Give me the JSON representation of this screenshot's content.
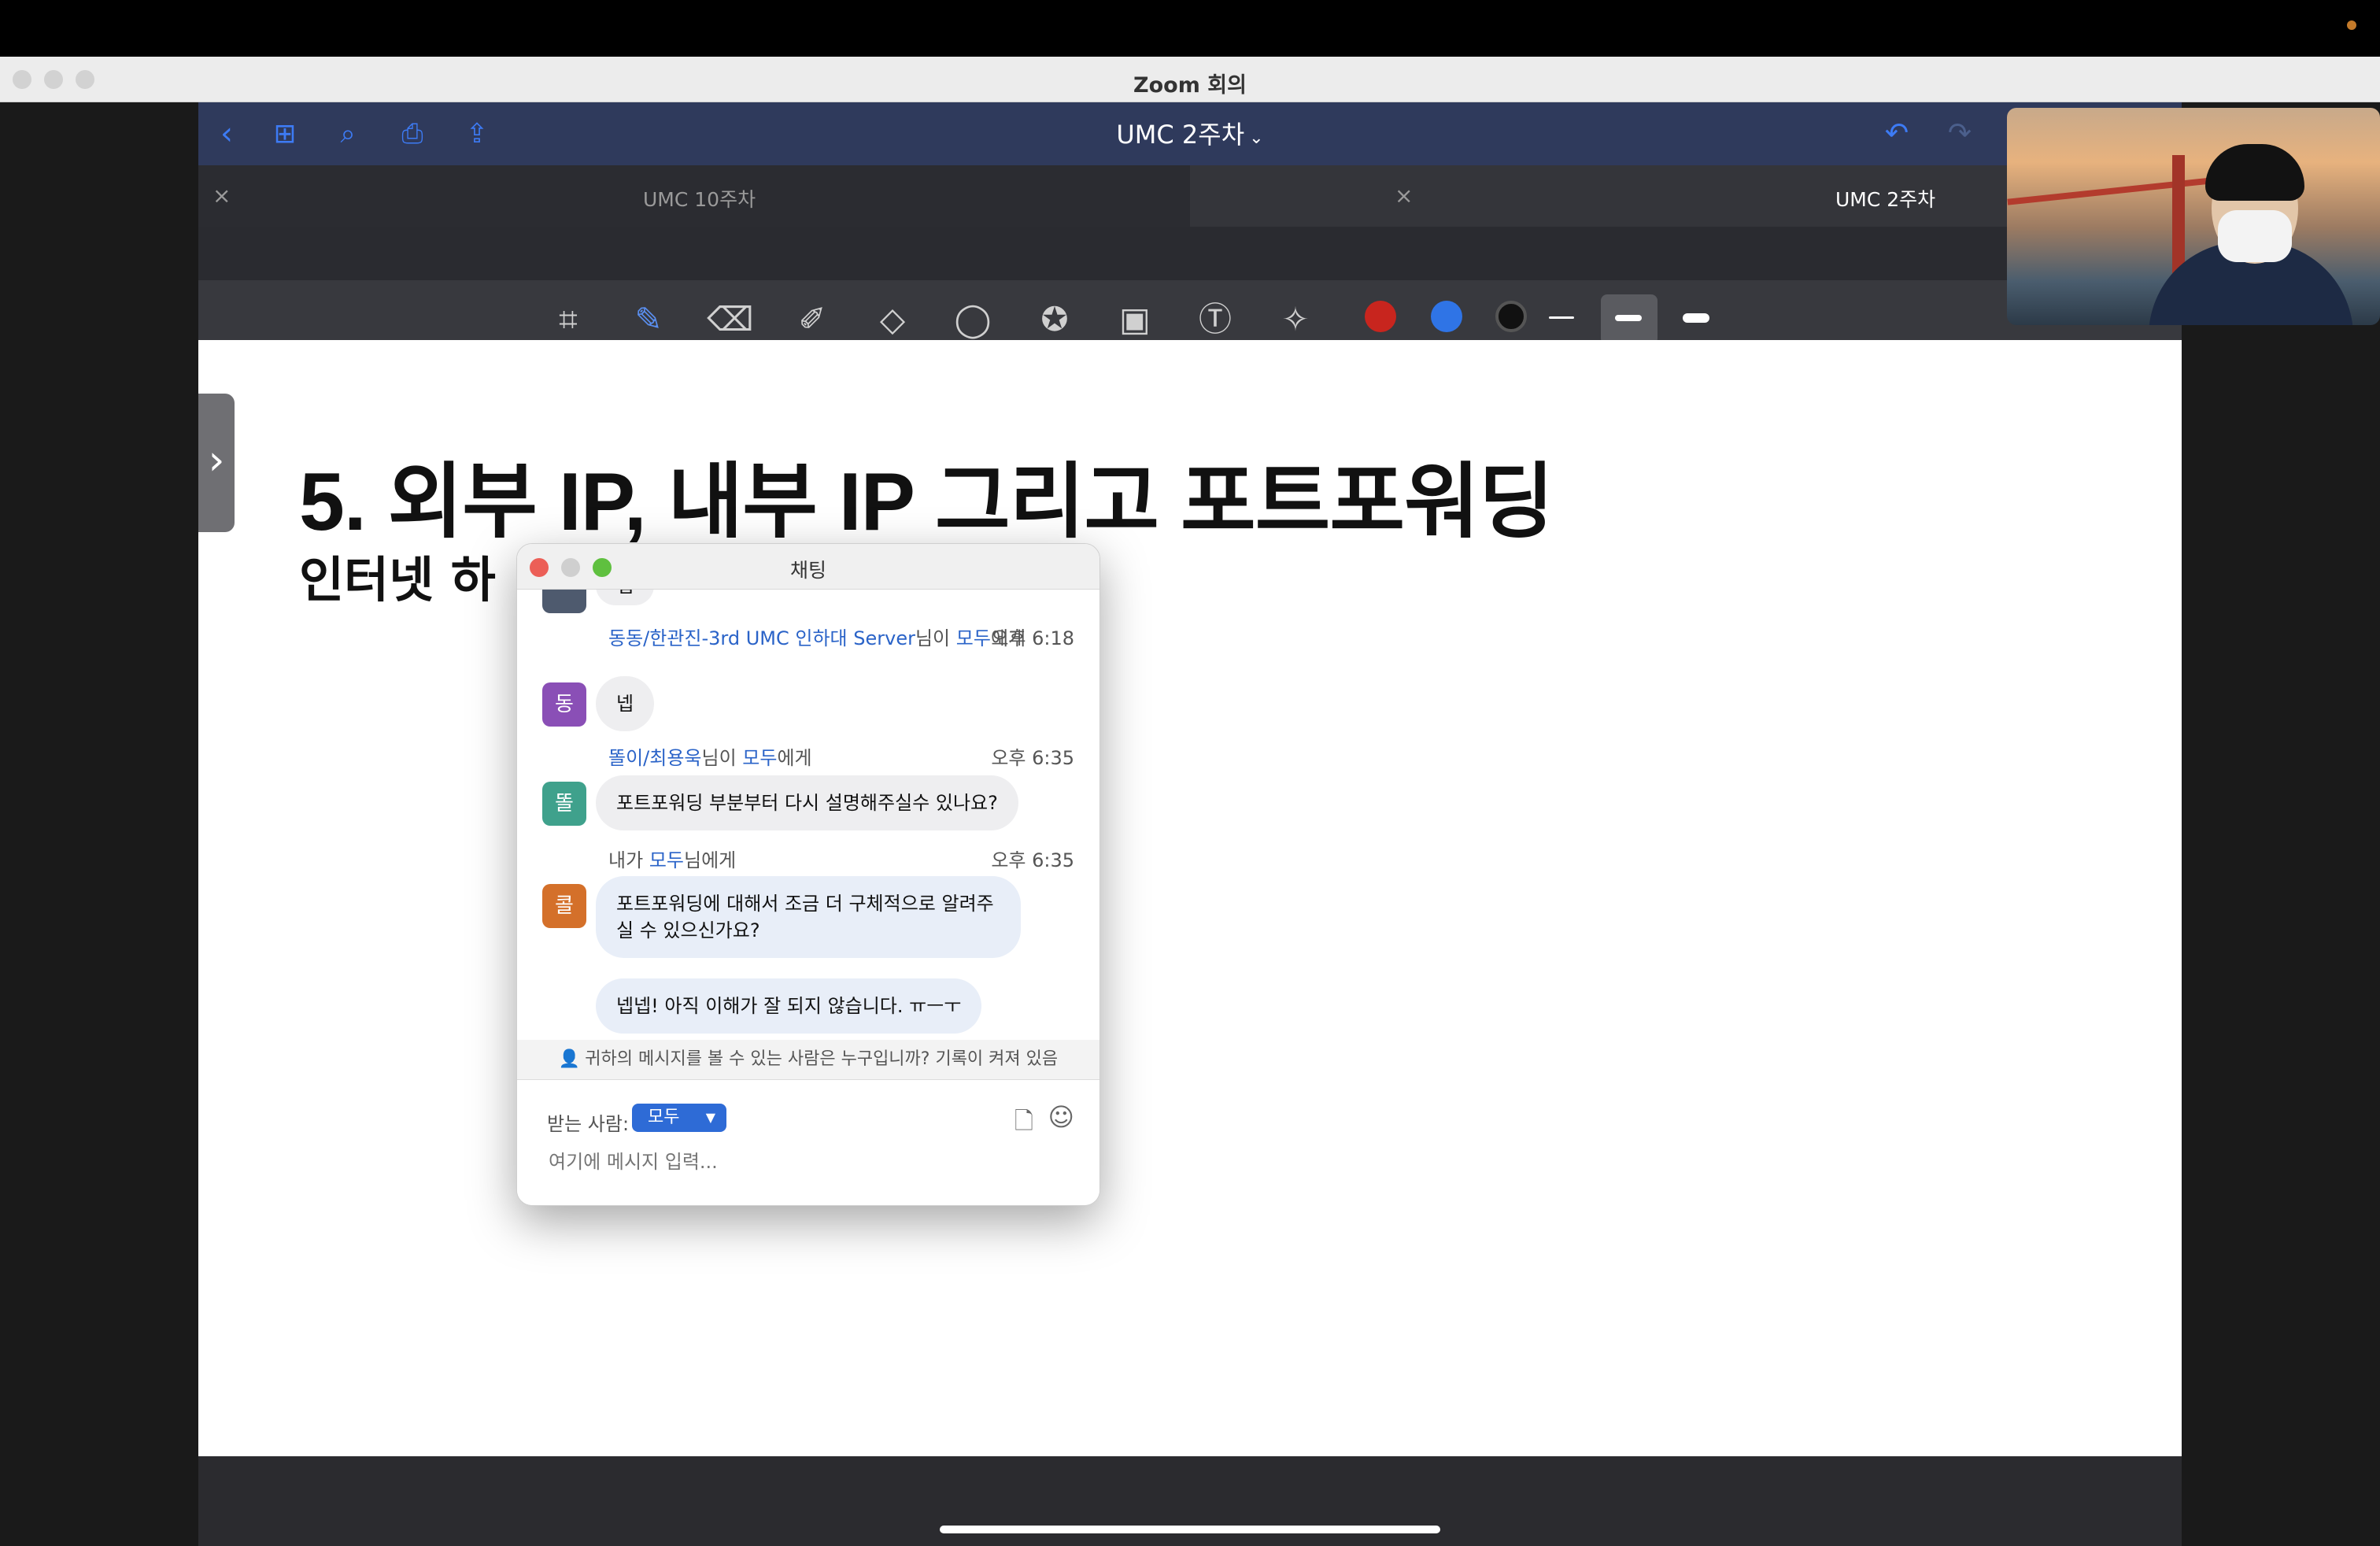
{
  "window": {
    "title": "Zoom 회의"
  },
  "goodnotes": {
    "doc_title": "UMC 2주차",
    "tabs": [
      {
        "label": "UMC 10주차"
      },
      {
        "label": "UMC 2주차"
      }
    ],
    "colors": [
      "#c8251e",
      "#2f74e6",
      "#111111"
    ]
  },
  "page": {
    "title": "5. 외부 IP, 내부 IP 그리고 포트포워딩",
    "subtitle": "인터넷 하"
  },
  "chat": {
    "title": "채팅",
    "top_partial": "넵",
    "messages": [
      {
        "avatar": "동",
        "sender": "동동/한관진-3rd UMC 인하대 Server",
        "mid": "님이 ",
        "to": "모두",
        "suffix": "에게",
        "time": "오후 6:18",
        "text": "넵"
      },
      {
        "avatar": "똘",
        "sender": "똘이/최용욱",
        "mid": "님이 ",
        "to": "모두",
        "suffix": "에게",
        "time": "오후 6:35",
        "text": "포트포워딩 부분부터 다시 설명해주실수 있나요?"
      },
      {
        "avatar": "콜",
        "sender": "내가",
        "mid": " ",
        "to": "모두",
        "suffix": "님에게",
        "time": "오후 6:35",
        "text": "포트포워딩에 대해서 조금 더 구체적으로 알려주실 수 있으신가요?",
        "text2": "넵넵! 아직 이해가 잘 되지 않습니다. ㅠㅡㅜ"
      }
    ],
    "notice": "귀하의 메시지를 볼 수 있는 사람은 누구입니까? 기록이 켜져 있음",
    "to_label": "받는 사람:",
    "to_value": "모두",
    "input_placeholder": "여기에 메시지 입력..."
  }
}
